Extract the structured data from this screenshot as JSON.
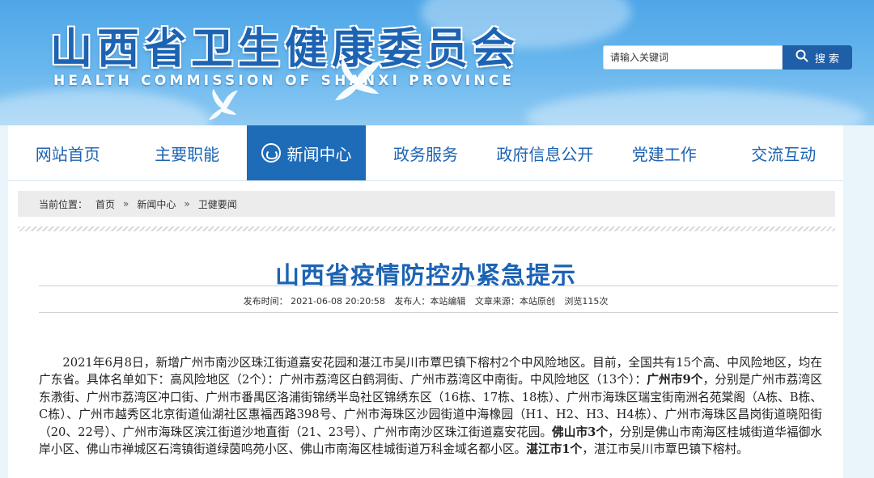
{
  "header": {
    "title": "山西省卫生健康委员会",
    "subtitle": "HEALTH COMMISSION OF SHANXI PROVINCE",
    "search_placeholder": "请输入关键词",
    "search_button": "搜 索"
  },
  "nav": {
    "items": [
      {
        "label": "网站首页"
      },
      {
        "label": "主要职能"
      },
      {
        "label": "新闻中心"
      },
      {
        "label": "政务服务"
      },
      {
        "label": "政府信息公开"
      },
      {
        "label": "党建工作"
      },
      {
        "label": "交流互动"
      }
    ],
    "active_index": 2
  },
  "breadcrumb": {
    "prefix": "当前位置：",
    "items": [
      "首页",
      "新闻中心",
      "卫健要闻"
    ],
    "separator": "»"
  },
  "article": {
    "title": "山西省疫情防控办紧急提示",
    "meta": {
      "published": "发布时间： 2021-06-08 20:20:58",
      "author": "发布人：本站编辑",
      "source": "文章来源：本站原创",
      "views": "浏览115次"
    },
    "body": {
      "p1": "2021年6月8日，新增广州市南沙区珠江街道嘉安花园和湛江市吴川市覃巴镇下榕村2个中风险地区。目前，全国共有15个高、中风险地区，均在广东省。具体名单如下：高风险地区（2个）：广州市荔湾区白鹤洞街、广州市荔湾区中南街。中风险地区（13个）：",
      "b1": "广州市9个",
      "p2": "，分别是广州市荔湾区东漖街、广州市荔湾区冲口街、广州市番禺区洛浦街锦绣半岛社区锦绣东区（16栋、17栋、18栋）、广州市海珠区瑞宝街南洲名苑棠阁（A栋、B栋、C栋）、广州市越秀区北京街道仙湖社区惠福西路398号、广州市海珠区沙园街道中海橡园（H1、H2、H3、H4栋）、广州市海珠区昌岗街道晓阳街（20、22号）、广州市海珠区滨江街道沙地直街（21、23号）、广州市南沙区珠江街道嘉安花园。",
      "b2": "佛山市3个",
      "p3": "，分别是佛山市南海区桂城街道华福御水岸小区、佛山市禅城区石湾镇街道绿茵鸣苑小区、佛山市南海区桂城街道万科金域名都小区。",
      "b3": "湛江市1个",
      "p4": "，湛江市吴川市覃巴镇下榕村。"
    }
  },
  "colors": {
    "brand_blue": "#1d63b3",
    "nav_active": "#1e6cb8",
    "banner_top": "#4ea6e8"
  }
}
